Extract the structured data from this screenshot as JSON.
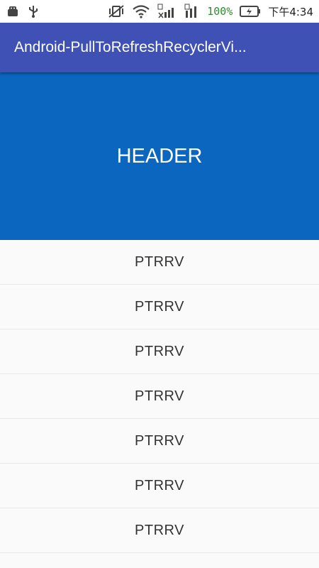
{
  "status_bar": {
    "battery_percent": "100%",
    "time": "下午4:34",
    "icons": [
      "android-debug-icon",
      "usb-icon",
      "vibrate-off-icon",
      "wifi-icon",
      "sim1-signal-icon",
      "sim2-signal-icon",
      "battery-icon"
    ]
  },
  "toolbar": {
    "title": "Android-PullToRefreshRecyclerVi..."
  },
  "header": {
    "text": "HEADER"
  },
  "list": {
    "items": [
      {
        "label": "PTRRV"
      },
      {
        "label": "PTRRV"
      },
      {
        "label": "PTRRV"
      },
      {
        "label": "PTRRV"
      },
      {
        "label": "PTRRV"
      },
      {
        "label": "PTRRV"
      },
      {
        "label": "PTRRV"
      }
    ]
  },
  "colors": {
    "toolbar": "#3f51b5",
    "header": "#0a66be",
    "background": "#fafafa",
    "battery_text": "#2e8b2e"
  }
}
